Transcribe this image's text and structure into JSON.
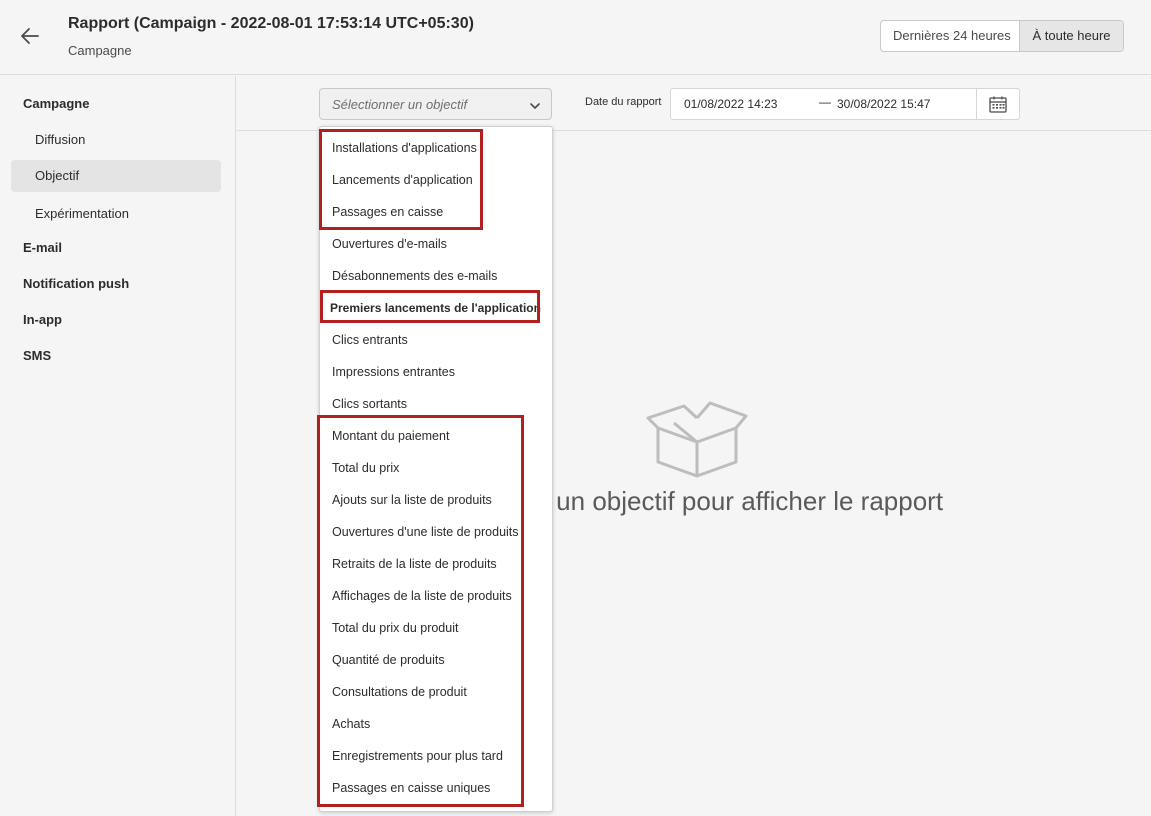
{
  "header": {
    "title": "Rapport (Campaign - 2022-08-01 17:53:14 UTC+05:30)",
    "subtitle": "Campagne",
    "time_toggle": [
      "Dernières 24 heures",
      "À toute heure"
    ],
    "time_toggle_selected": "À toute heure"
  },
  "sidebar": {
    "sections": [
      {
        "label": "Campagne",
        "items": [
          "Diffusion",
          "Objectif",
          "Expérimentation"
        ],
        "selected": "Objectif"
      },
      {
        "label": "E-mail"
      },
      {
        "label": "Notification push"
      },
      {
        "label": "In-app"
      },
      {
        "label": "SMS"
      }
    ]
  },
  "toolbar": {
    "objective_placeholder": "Sélectionner un objectif",
    "date_label": "Date du rapport",
    "date_start": "01/08/2022 14:23",
    "date_separator": "—",
    "date_end": "30/08/2022 15:47"
  },
  "empty_state": {
    "message": "nner un objectif pour afficher le rapport"
  },
  "dropdown": {
    "items": [
      "Installations d'applications",
      "Lancements d'application",
      "Passages en caisse",
      "Ouvertures d'e-mails",
      "Désabonnements des e-mails",
      "Premiers lancements de l'application",
      "Clics entrants",
      "Impressions entrantes",
      "Clics sortants",
      "Montant du paiement",
      "Total du prix",
      "Ajouts sur la liste de produits",
      "Ouvertures d'une liste de produits",
      "Retraits de la liste de produits",
      "Affichages de la liste de produits",
      "Total du prix du produit",
      "Quantité de produits",
      "Consultations de produit",
      "Achats",
      "Enregistrements pour plus tard",
      "Passages en caisse uniques"
    ]
  },
  "colors": {
    "highlight": "#b41f1f",
    "background": "#f5f5f5"
  }
}
